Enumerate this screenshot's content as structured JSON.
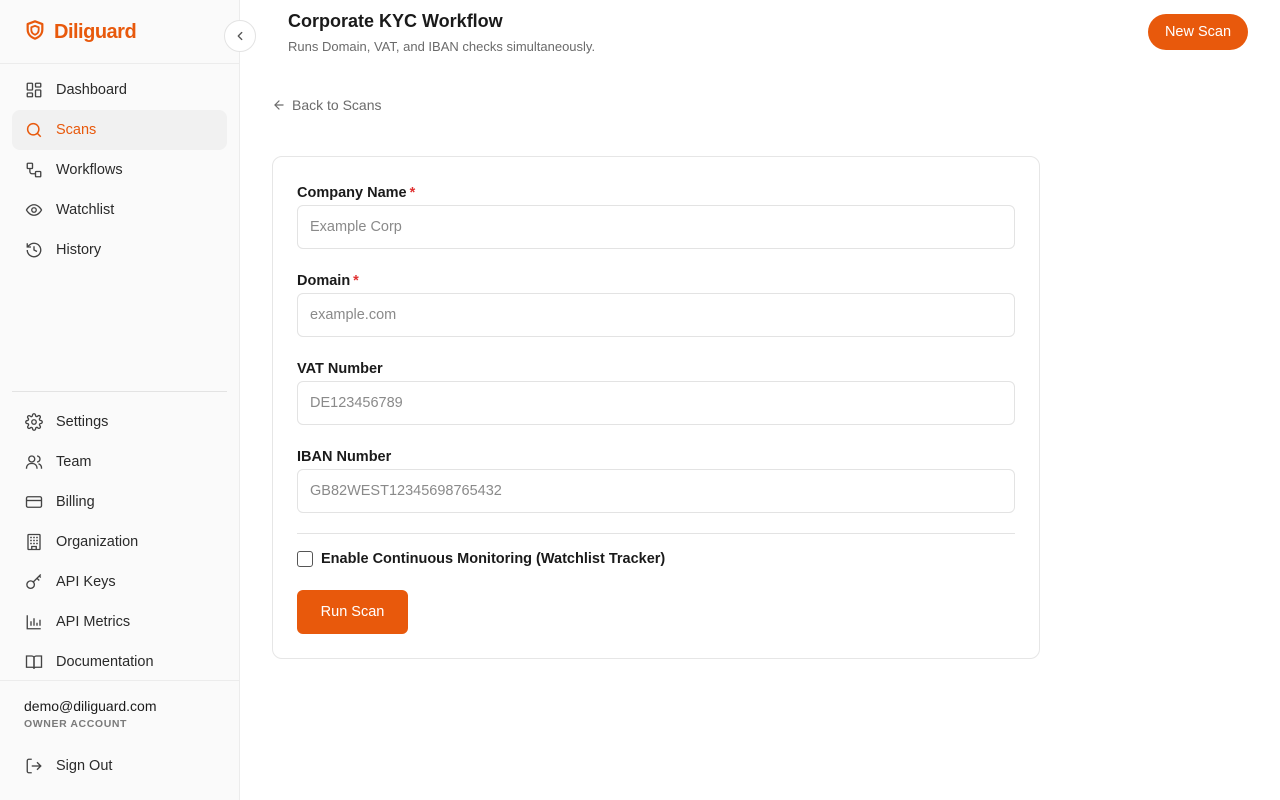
{
  "brand": {
    "name": "Diliguard",
    "accent": "#e8590c"
  },
  "sidebar": {
    "top_items": [
      {
        "label": "Dashboard",
        "icon": "dashboard-icon",
        "active": false
      },
      {
        "label": "Scans",
        "icon": "search-icon",
        "active": true
      },
      {
        "label": "Workflows",
        "icon": "workflow-icon",
        "active": false
      },
      {
        "label": "Watchlist",
        "icon": "eye-icon",
        "active": false
      },
      {
        "label": "History",
        "icon": "history-icon",
        "active": false
      }
    ],
    "bottom_items": [
      {
        "label": "Settings",
        "icon": "gear-icon"
      },
      {
        "label": "Team",
        "icon": "team-icon"
      },
      {
        "label": "Billing",
        "icon": "credit-card-icon"
      },
      {
        "label": "Organization",
        "icon": "building-icon"
      },
      {
        "label": "API Keys",
        "icon": "key-icon"
      },
      {
        "label": "API Metrics",
        "icon": "bar-chart-icon"
      },
      {
        "label": "Documentation",
        "icon": "book-icon"
      }
    ],
    "user": {
      "email": "demo@diliguard.com",
      "role": "OWNER ACCOUNT"
    },
    "sign_out": {
      "label": "Sign Out",
      "icon": "sign-out-icon"
    }
  },
  "header": {
    "title": "Corporate KYC Workflow",
    "subtitle": "Runs Domain, VAT, and IBAN checks simultaneously.",
    "new_scan_label": "New Scan"
  },
  "back_link": {
    "label": "Back to Scans"
  },
  "form": {
    "fields": [
      {
        "label": "Company Name",
        "required": true,
        "value": "",
        "placeholder": "Example Corp"
      },
      {
        "label": "Domain",
        "required": true,
        "value": "",
        "placeholder": "example.com"
      },
      {
        "label": "VAT Number",
        "required": false,
        "value": "",
        "placeholder": "DE123456789"
      },
      {
        "label": "IBAN Number",
        "required": false,
        "value": "",
        "placeholder": "GB82WEST12345698765432"
      }
    ],
    "monitoring_label": "Enable Continuous Monitoring (Watchlist Tracker)",
    "monitoring_checked": false,
    "submit_label": "Run Scan"
  }
}
